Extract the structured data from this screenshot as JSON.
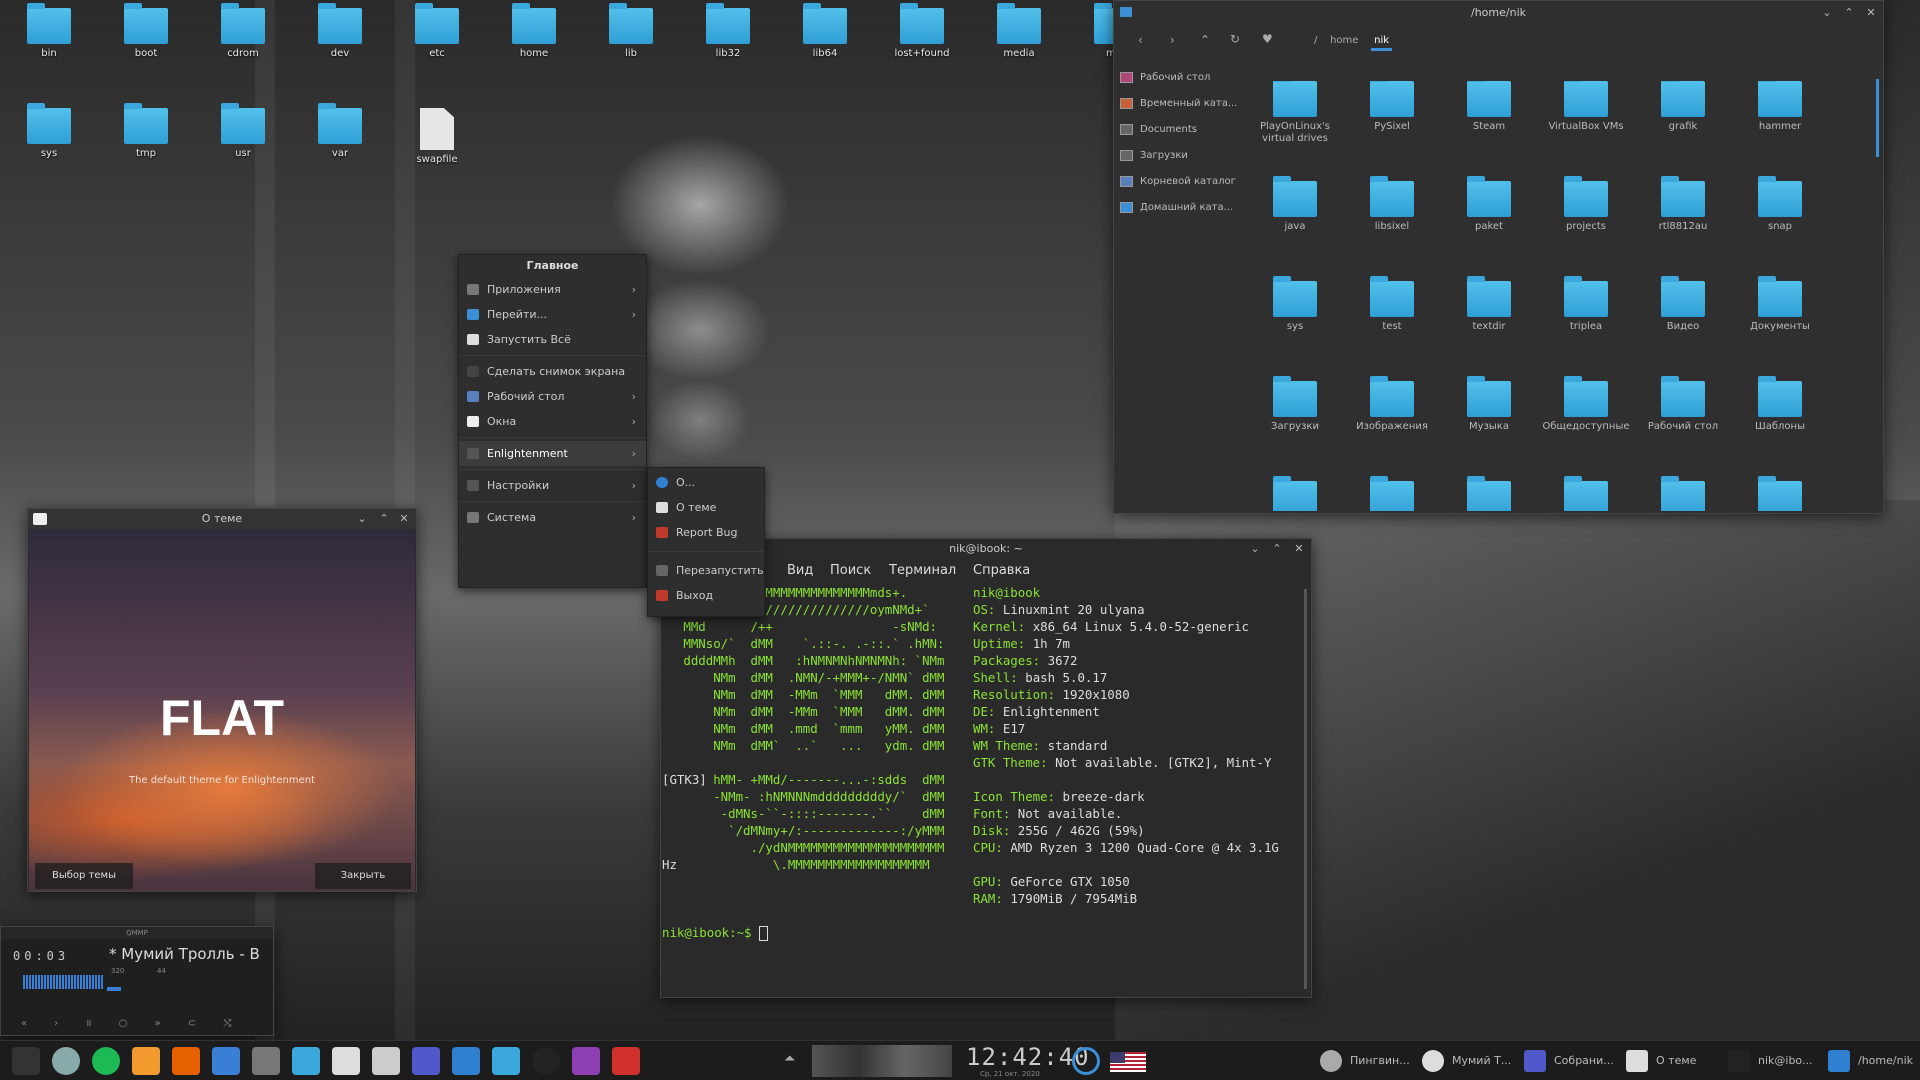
{
  "desktop_icons": [
    {
      "label": "bin",
      "type": "folder"
    },
    {
      "label": "boot",
      "type": "folder"
    },
    {
      "label": "cdrom",
      "type": "folder"
    },
    {
      "label": "dev",
      "type": "folder"
    },
    {
      "label": "etc",
      "type": "folder"
    },
    {
      "label": "home",
      "type": "folder"
    },
    {
      "label": "lib",
      "type": "folder"
    },
    {
      "label": "lib32",
      "type": "folder"
    },
    {
      "label": "lib64",
      "type": "folder"
    },
    {
      "label": "lost+found",
      "type": "folder"
    },
    {
      "label": "media",
      "type": "folder"
    },
    {
      "label": "mnt",
      "type": "folder"
    },
    {
      "label": "sys",
      "type": "folder"
    },
    {
      "label": "tmp",
      "type": "folder"
    },
    {
      "label": "usr",
      "type": "folder"
    },
    {
      "label": "var",
      "type": "folder"
    },
    {
      "label": "swapfile",
      "type": "file"
    }
  ],
  "main_menu": {
    "title": "Главное",
    "items": [
      {
        "label": "Приложения",
        "submenu": true,
        "icon": "gear-icon",
        "color": "#777"
      },
      {
        "label": "Перейти...",
        "submenu": true,
        "icon": "folder-icon",
        "color": "#3a8fd6"
      },
      {
        "label": "Запустить Всё",
        "submenu": false,
        "icon": "run-icon",
        "color": "#ddd"
      },
      {
        "sep": true
      },
      {
        "label": "Сделать снимок экрана",
        "submenu": false,
        "icon": "camera-icon",
        "color": "#444"
      },
      {
        "label": "Рабочий стол",
        "submenu": true,
        "icon": "desktop-icon",
        "color": "#5a7fbf"
      },
      {
        "label": "Окна",
        "submenu": true,
        "icon": "window-icon",
        "color": "#eee"
      },
      {
        "sep": true
      },
      {
        "label": "Enlightenment",
        "submenu": true,
        "icon": "enlightenment-icon",
        "color": "#555",
        "active": true
      },
      {
        "sep": true
      },
      {
        "label": "Настройки",
        "submenu": true,
        "icon": "settings-icon",
        "color": "#555"
      },
      {
        "sep": true
      },
      {
        "label": "Система",
        "submenu": true,
        "icon": "system-icon",
        "color": "#777"
      }
    ]
  },
  "submenu": {
    "items": [
      {
        "label": "О...",
        "icon": "info-icon",
        "color": "#2f80d1"
      },
      {
        "label": "О теме",
        "icon": "theme-icon",
        "color": "#ddd"
      },
      {
        "label": "Report Bug",
        "icon": "bug-icon",
        "color": "#c0392b"
      },
      {
        "sep": true
      },
      {
        "label": "Перезапустить",
        "icon": "restart-icon",
        "color": "#666"
      },
      {
        "label": "Выход",
        "icon": "exit-icon",
        "color": "#c0392b"
      }
    ]
  },
  "theme_window": {
    "title": "О теме",
    "heading": "FLAT",
    "subtitle": "The default theme for Enlightenment",
    "btn_choose": "Выбор темы",
    "btn_close": "Закрыть"
  },
  "file_manager": {
    "title": "/home/nik",
    "path": [
      "/",
      "home",
      "nik"
    ],
    "sidebar": [
      "Рабочий стол",
      "Временный ката...",
      "Documents",
      "Загрузки",
      "Корневой каталог",
      "Домашний ката..."
    ],
    "items": [
      "PlayOnLinux's virtual drives",
      "PySixel",
      "Steam",
      "VirtualBox VMs",
      "grafik",
      "hammer",
      "java",
      "libsixel",
      "paket",
      "projects",
      "rtl8812au",
      "snap",
      "sys",
      "test",
      "textdir",
      "triplea",
      "Видео",
      "Документы",
      "Загрузки",
      "Изображения",
      "Музыка",
      "Общедоступные",
      "Рабочий стол",
      "Шаблоны",
      "",
      "",
      "",
      "",
      "",
      ""
    ]
  },
  "terminal": {
    "title": "nik@ibook: ~",
    "menu": [
      "а",
      "Вид",
      "Поиск",
      "Терминал",
      "Справка"
    ],
    "logo": [
      "             MMMMMMMMMMMMMMMmds+.",
      "   MMm----::-://////////////oymNMd+`",
      "   MMd      /++                -sNMd:",
      "   MMNso/`  dMM    `.::-. .-::.` .hMN:",
      "   ddddMMh  dMM   :hNMNMNhNMNMNh: `NMm",
      "       NMm  dMM  .NMN/-+MMM+-/NMN` dMM",
      "       NMm  dMM  -MMm  `MMM   dMM. dMM",
      "       NMm  dMM  -MMm  `MMM   dMM. dMM",
      "       NMm  dMM  .mmd  `mmm   yMM. dMM",
      "       NMm  dMM`  ..`   ...   ydm. dMM",
      "       hMM- +MMd/-------...-:sdds  dMM",
      "       -NMm- :hNMNNNmdddddddddy/`  dMM",
      "        -dMNs-``-::::-------.``    dMM",
      "         `/dMNmy+/:-------------:/yMMM",
      "",
      "            ./ydNMMMMMMMMMMMMMMMMMMMMM",
      "               \\.MMMMMMMMMMMMMMMMMMM"
    ],
    "info": [
      {
        "k": "",
        "v": "nik@ibook",
        "full": true
      },
      {
        "k": "OS:",
        "v": "Linuxmint 20 ulyana"
      },
      {
        "k": "Kernel:",
        "v": "x86_64 Linux 5.4.0-52-generic"
      },
      {
        "k": "Uptime:",
        "v": "1h 7m"
      },
      {
        "k": "Packages:",
        "v": "3672"
      },
      {
        "k": "Shell:",
        "v": "bash 5.0.17"
      },
      {
        "k": "Resolution:",
        "v": "1920x1080"
      },
      {
        "k": "DE:",
        "v": "Enlightenment"
      },
      {
        "k": "WM:",
        "v": "E17"
      },
      {
        "k": "WM Theme:",
        "v": "standard"
      },
      {
        "k": "GTK Theme:",
        "v": "Not available. [GTK2], Mint-Y"
      },
      {
        "k": "Icon Theme:",
        "v": "breeze-dark"
      },
      {
        "k": "Font:",
        "v": "Not available."
      },
      {
        "k": "Disk:",
        "v": "255G / 462G (59%)"
      },
      {
        "k": "CPU:",
        "v": "AMD Ryzen 3 1200 Quad-Core @ 4x 3.1G"
      },
      {
        "k": "GPU:",
        "v": "GeForce GTX 1050"
      },
      {
        "k": "RAM:",
        "v": "1790MiB / 7954MiB"
      }
    ],
    "wrap1": "[GTK3]",
    "wrap2": "Hz",
    "prompt": "nik@ibook:~$ "
  },
  "qmmp": {
    "title": "QMMP",
    "time": "00:03",
    "track": "* Мумий Тролль - В",
    "kbps": "320",
    "khz": "44"
  },
  "taskbar": {
    "clock": "12:42:40",
    "date": "Ср, 21 окт. 2020",
    "launchers": [
      {
        "name": "terminal-icon",
        "color": "#333"
      },
      {
        "name": "globe-icon",
        "color": "#8aa"
      },
      {
        "name": "spotify-icon",
        "color": "#1db954"
      },
      {
        "name": "sublime-icon",
        "color": "#f29a2e"
      },
      {
        "name": "firefox-icon",
        "color": "#e66000"
      },
      {
        "name": "bluetooth-icon",
        "color": "#3a7fd6"
      },
      {
        "name": "screenshot-icon",
        "color": "#777"
      },
      {
        "name": "files-icon",
        "color": "#3aa8dc"
      },
      {
        "name": "monitor-icon",
        "color": "#ddd"
      },
      {
        "name": "enlightenment-icon",
        "color": "#ccc"
      },
      {
        "name": "teams-icon",
        "color": "#5059c9"
      },
      {
        "name": "filemanager-icon",
        "color": "#2f80d1"
      },
      {
        "name": "screenshot2-icon",
        "color": "#3aa8dc"
      },
      {
        "name": "power-icon",
        "color": "#222"
      },
      {
        "name": "firefox2-icon",
        "color": "#8e3fb4"
      },
      {
        "name": "close-app-icon",
        "color": "#d0312d"
      }
    ],
    "tasks": [
      {
        "label": "Пингвин...",
        "color": "#aaa",
        "icon": "penguin-icon"
      },
      {
        "label": "Мумий Т...",
        "color": "#ddd",
        "icon": "qmmp-icon"
      },
      {
        "label": "Собрани...",
        "color": "#5059c9",
        "icon": "teams-icon"
      },
      {
        "label": "О теме",
        "color": "#ddd",
        "icon": "theme-icon"
      },
      {
        "label": "nik@ibo...",
        "color": "#222",
        "icon": "terminal-icon"
      },
      {
        "label": "/home/nik",
        "color": "#2f80d1",
        "icon": "folder-icon"
      }
    ]
  }
}
